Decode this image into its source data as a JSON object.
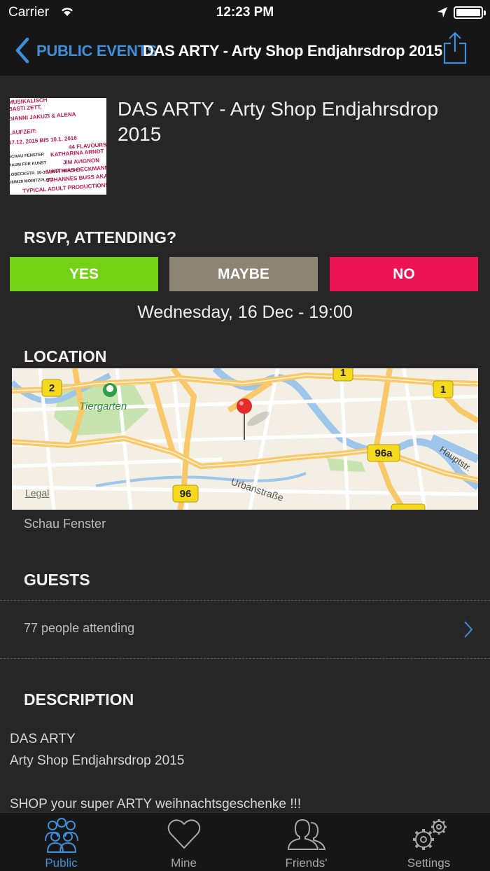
{
  "status": {
    "carrier": "Carrier",
    "time": "12:23 PM"
  },
  "nav": {
    "back_label": "PUBLIC EVENTS",
    "title": "DAS ARTY - Arty Shop Endjahrsdrop 2015"
  },
  "event": {
    "title": "DAS ARTY - Arty Shop Endjahrsdrop 2015",
    "poster_lines": [
      "MUSIKALISCH",
      "BASTI ZETT,",
      "GIANNI JAKUZI & ALENA",
      "LAUFZEIT:",
      "17.12. 2015 BIS 10.1. 2016",
      "44 FLAVOURS",
      "SCHAU FENSTER",
      "KATHARINA ARNDT",
      "RAUM FÜR KUNST",
      "JIM AVIGNON",
      "LOBECKSTR. 30-35 10969 BERLIN",
      "MATTHIAS BECKMANN",
      "U8/M29 MORITZPLATZ",
      "JOHANNES BUSS AKA",
      "TYPICAL ADULT PRODUCTIONS"
    ]
  },
  "rsvp": {
    "heading": "RSVP, ATTENDING?",
    "yes": "YES",
    "maybe": "MAYBE",
    "no": "NO"
  },
  "datetime": "Wednesday, 16 Dec - 19:00",
  "location": {
    "heading": "LOCATION",
    "venue": "Schau Fenster",
    "map": {
      "park": "Tiergarten",
      "street": "Urbanstraße",
      "street2": "Hauptstr.",
      "road_badges": [
        "2",
        "1",
        "1",
        "96a",
        "96"
      ],
      "legal": "Legal"
    }
  },
  "guests": {
    "heading": "GUESTS",
    "attending": "77 people attending"
  },
  "description": {
    "heading": "DESCRIPTION",
    "body": "DAS ARTY\nArty Shop Endjahrsdrop 2015\n\nSHOP your super ARTY weihnachtsgeschenke !!!"
  },
  "tabs": [
    {
      "label": "Public",
      "icon": "people-group-icon",
      "active": true
    },
    {
      "label": "Mine",
      "icon": "heart-icon",
      "active": false
    },
    {
      "label": "Friends'",
      "icon": "friends-icon",
      "active": false
    },
    {
      "label": "Settings",
      "icon": "gears-icon",
      "active": false
    }
  ],
  "colors": {
    "accent": "#3f8ed8",
    "yes": "#73d216",
    "maybe": "#8e8474",
    "no": "#ec1354",
    "background": "#262626",
    "bars": "#161616"
  }
}
